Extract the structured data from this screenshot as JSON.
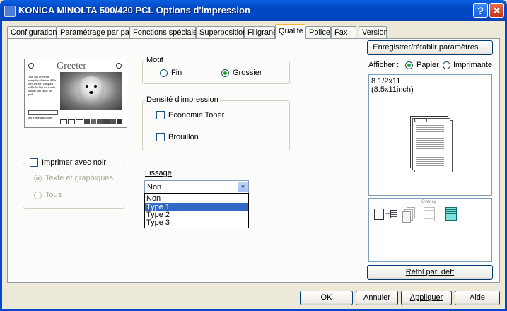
{
  "window": {
    "title": "KONICA MINOLTA 500/420 PCL Options d'impression",
    "help_btn": "?",
    "close_btn": "✕"
  },
  "tabs": [
    "Configuration",
    "Paramétrage par page",
    "Fonctions spéciales",
    "Superposition",
    "Filigrane",
    "Qualité",
    "Police",
    "Fax",
    "Version"
  ],
  "active_tab": "Qualité",
  "preview_image": {
    "heading": "Greeter",
    "body_text": "This dog gives me everyday pleasure. All is well for me. Tonight I will take him for a walk and let him enjoy the park.",
    "caption": "It's a fine day today"
  },
  "motif": {
    "title": "Motif",
    "options": [
      "Fin",
      "Grossier"
    ],
    "selected": "Grossier"
  },
  "densite": {
    "title": "Densité d'impression",
    "economie_toner": "Economie Toner",
    "brouillon": "Brouillon"
  },
  "imprimer_noir": {
    "title": "Imprimer avec noir",
    "options": [
      "Texte et graphiques",
      "Tous"
    ],
    "selected": "Texte et graphiques"
  },
  "lissage": {
    "label": "Lissage",
    "value": "Non",
    "options": [
      "Non",
      "Type 1",
      "Type 2",
      "Type 3"
    ],
    "highlighted": "Type 1"
  },
  "right_panel": {
    "save_btn": "Enregistrer/rétablir paramètres ...",
    "afficher_label": "Afficher :",
    "afficher_options": [
      "Papier",
      "Imprimante"
    ],
    "afficher_selected": "Papier",
    "paper_size": "8 1/2x11",
    "paper_dims": "(8.5x11inch)",
    "overlay_label": "Overlay",
    "reset_btn": "Rétbl par. deft"
  },
  "footer": {
    "ok": "OK",
    "cancel": "Annuler",
    "apply": "Appliquer",
    "help": "Aide"
  },
  "colors": {
    "title_bar": "#0a5fe0",
    "tab_highlight": "#f8b832",
    "selection": "#316ac5"
  }
}
